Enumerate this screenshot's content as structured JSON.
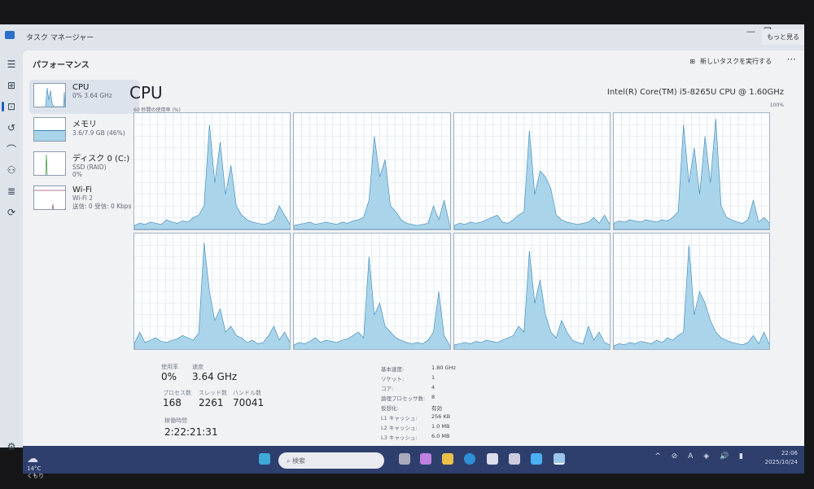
{
  "window": {
    "title": "タスク マネージャー",
    "more_label": "もっと見る",
    "minimize": "—",
    "restore": "❐"
  },
  "header": {
    "title": "パフォーマンス",
    "new_task": "新しいタスクを実行する",
    "more": "···"
  },
  "sidebar": [
    {
      "name": "CPU",
      "sub": "0% 3.64 GHz",
      "sub2": ""
    },
    {
      "name": "メモリ",
      "sub": "3.6/7.9 GB (46%)",
      "sub2": ""
    },
    {
      "name": "ディスク 0 (C:)",
      "sub": "SSD (RAID)",
      "sub2": "0%"
    },
    {
      "name": "Wi-Fi",
      "sub": "Wi-Fi 2",
      "sub2": "送信: 0 受信: 0 Kbps"
    }
  ],
  "memory_usage_percent": 46,
  "cpu": {
    "title": "CPU",
    "model": "Intel(R) Core(TM) i5-8265U CPU @ 1.60GHz",
    "graph_label": "60 秒間の使用率 (%)",
    "max_label": "100%"
  },
  "chart_data": {
    "type": "area",
    "ylim": [
      0,
      100
    ],
    "series": [
      {
        "name": "core0",
        "values": [
          3,
          5,
          4,
          6,
          5,
          4,
          8,
          6,
          5,
          7,
          6,
          10,
          12,
          20,
          90,
          40,
          75,
          30,
          55,
          20,
          12,
          8,
          6,
          5,
          4,
          5,
          8,
          20,
          12,
          4
        ]
      },
      {
        "name": "core1",
        "values": [
          3,
          4,
          5,
          6,
          4,
          5,
          6,
          5,
          4,
          6,
          5,
          7,
          8,
          10,
          25,
          80,
          45,
          60,
          20,
          15,
          8,
          5,
          4,
          3,
          4,
          5,
          20,
          8,
          25,
          4
        ]
      },
      {
        "name": "core2",
        "values": [
          3,
          5,
          4,
          6,
          5,
          6,
          8,
          10,
          12,
          6,
          5,
          8,
          12,
          15,
          85,
          30,
          50,
          45,
          35,
          12,
          8,
          6,
          5,
          4,
          5,
          6,
          10,
          5,
          12,
          4
        ]
      },
      {
        "name": "core3",
        "values": [
          5,
          7,
          6,
          8,
          7,
          6,
          8,
          7,
          6,
          8,
          7,
          10,
          15,
          90,
          40,
          70,
          30,
          80,
          40,
          95,
          20,
          10,
          8,
          6,
          5,
          8,
          25,
          6,
          10,
          5
        ]
      },
      {
        "name": "core4",
        "values": [
          5,
          15,
          6,
          8,
          10,
          7,
          6,
          8,
          9,
          12,
          10,
          8,
          14,
          92,
          50,
          25,
          35,
          15,
          20,
          12,
          10,
          6,
          8,
          5,
          6,
          12,
          20,
          8,
          15,
          6
        ]
      },
      {
        "name": "core5",
        "values": [
          4,
          6,
          5,
          7,
          10,
          6,
          8,
          7,
          6,
          8,
          9,
          12,
          15,
          10,
          80,
          30,
          40,
          20,
          15,
          10,
          8,
          6,
          5,
          6,
          5,
          8,
          15,
          50,
          12,
          4
        ]
      },
      {
        "name": "core6",
        "values": [
          4,
          5,
          6,
          5,
          7,
          6,
          8,
          7,
          6,
          8,
          10,
          12,
          20,
          15,
          85,
          40,
          60,
          30,
          15,
          10,
          25,
          15,
          8,
          6,
          5,
          20,
          8,
          15,
          6,
          4
        ]
      },
      {
        "name": "core7",
        "values": [
          3,
          5,
          4,
          6,
          5,
          7,
          6,
          5,
          8,
          6,
          10,
          8,
          12,
          15,
          90,
          30,
          50,
          40,
          25,
          15,
          10,
          8,
          6,
          5,
          4,
          6,
          12,
          5,
          15,
          4
        ]
      }
    ]
  },
  "stats": {
    "usage_label": "使用率",
    "usage": "0%",
    "speed_label": "速度",
    "speed": "3.64 GHz",
    "proc_label": "プロセス数",
    "proc": "168",
    "thread_label": "スレッド数",
    "thread": "2261",
    "handle_label": "ハンドル数",
    "handle": "70041",
    "uptime_label": "稼働時間",
    "uptime": "2:22:21:31"
  },
  "specs": [
    {
      "k": "基本速度:",
      "v": "1.80 GHz"
    },
    {
      "k": "ソケット:",
      "v": "1"
    },
    {
      "k": "コア:",
      "v": "4"
    },
    {
      "k": "論理プロセッサ数:",
      "v": "8"
    },
    {
      "k": "仮想化:",
      "v": "有効"
    },
    {
      "k": "L1 キャッシュ:",
      "v": "256 KB"
    },
    {
      "k": "L2 キャッシュ:",
      "v": "1.0 MB"
    },
    {
      "k": "L3 キャッシュ:",
      "v": "6.0 MB"
    }
  ],
  "taskbar": {
    "temp": "14°C",
    "weather": "くもり",
    "search": "検索",
    "time": "22:06",
    "date": "2025/10/24"
  },
  "colors": {
    "accent": "#1e5fbf",
    "graph_fill": "#a9d4ea",
    "graph_line": "#3a86b8"
  }
}
